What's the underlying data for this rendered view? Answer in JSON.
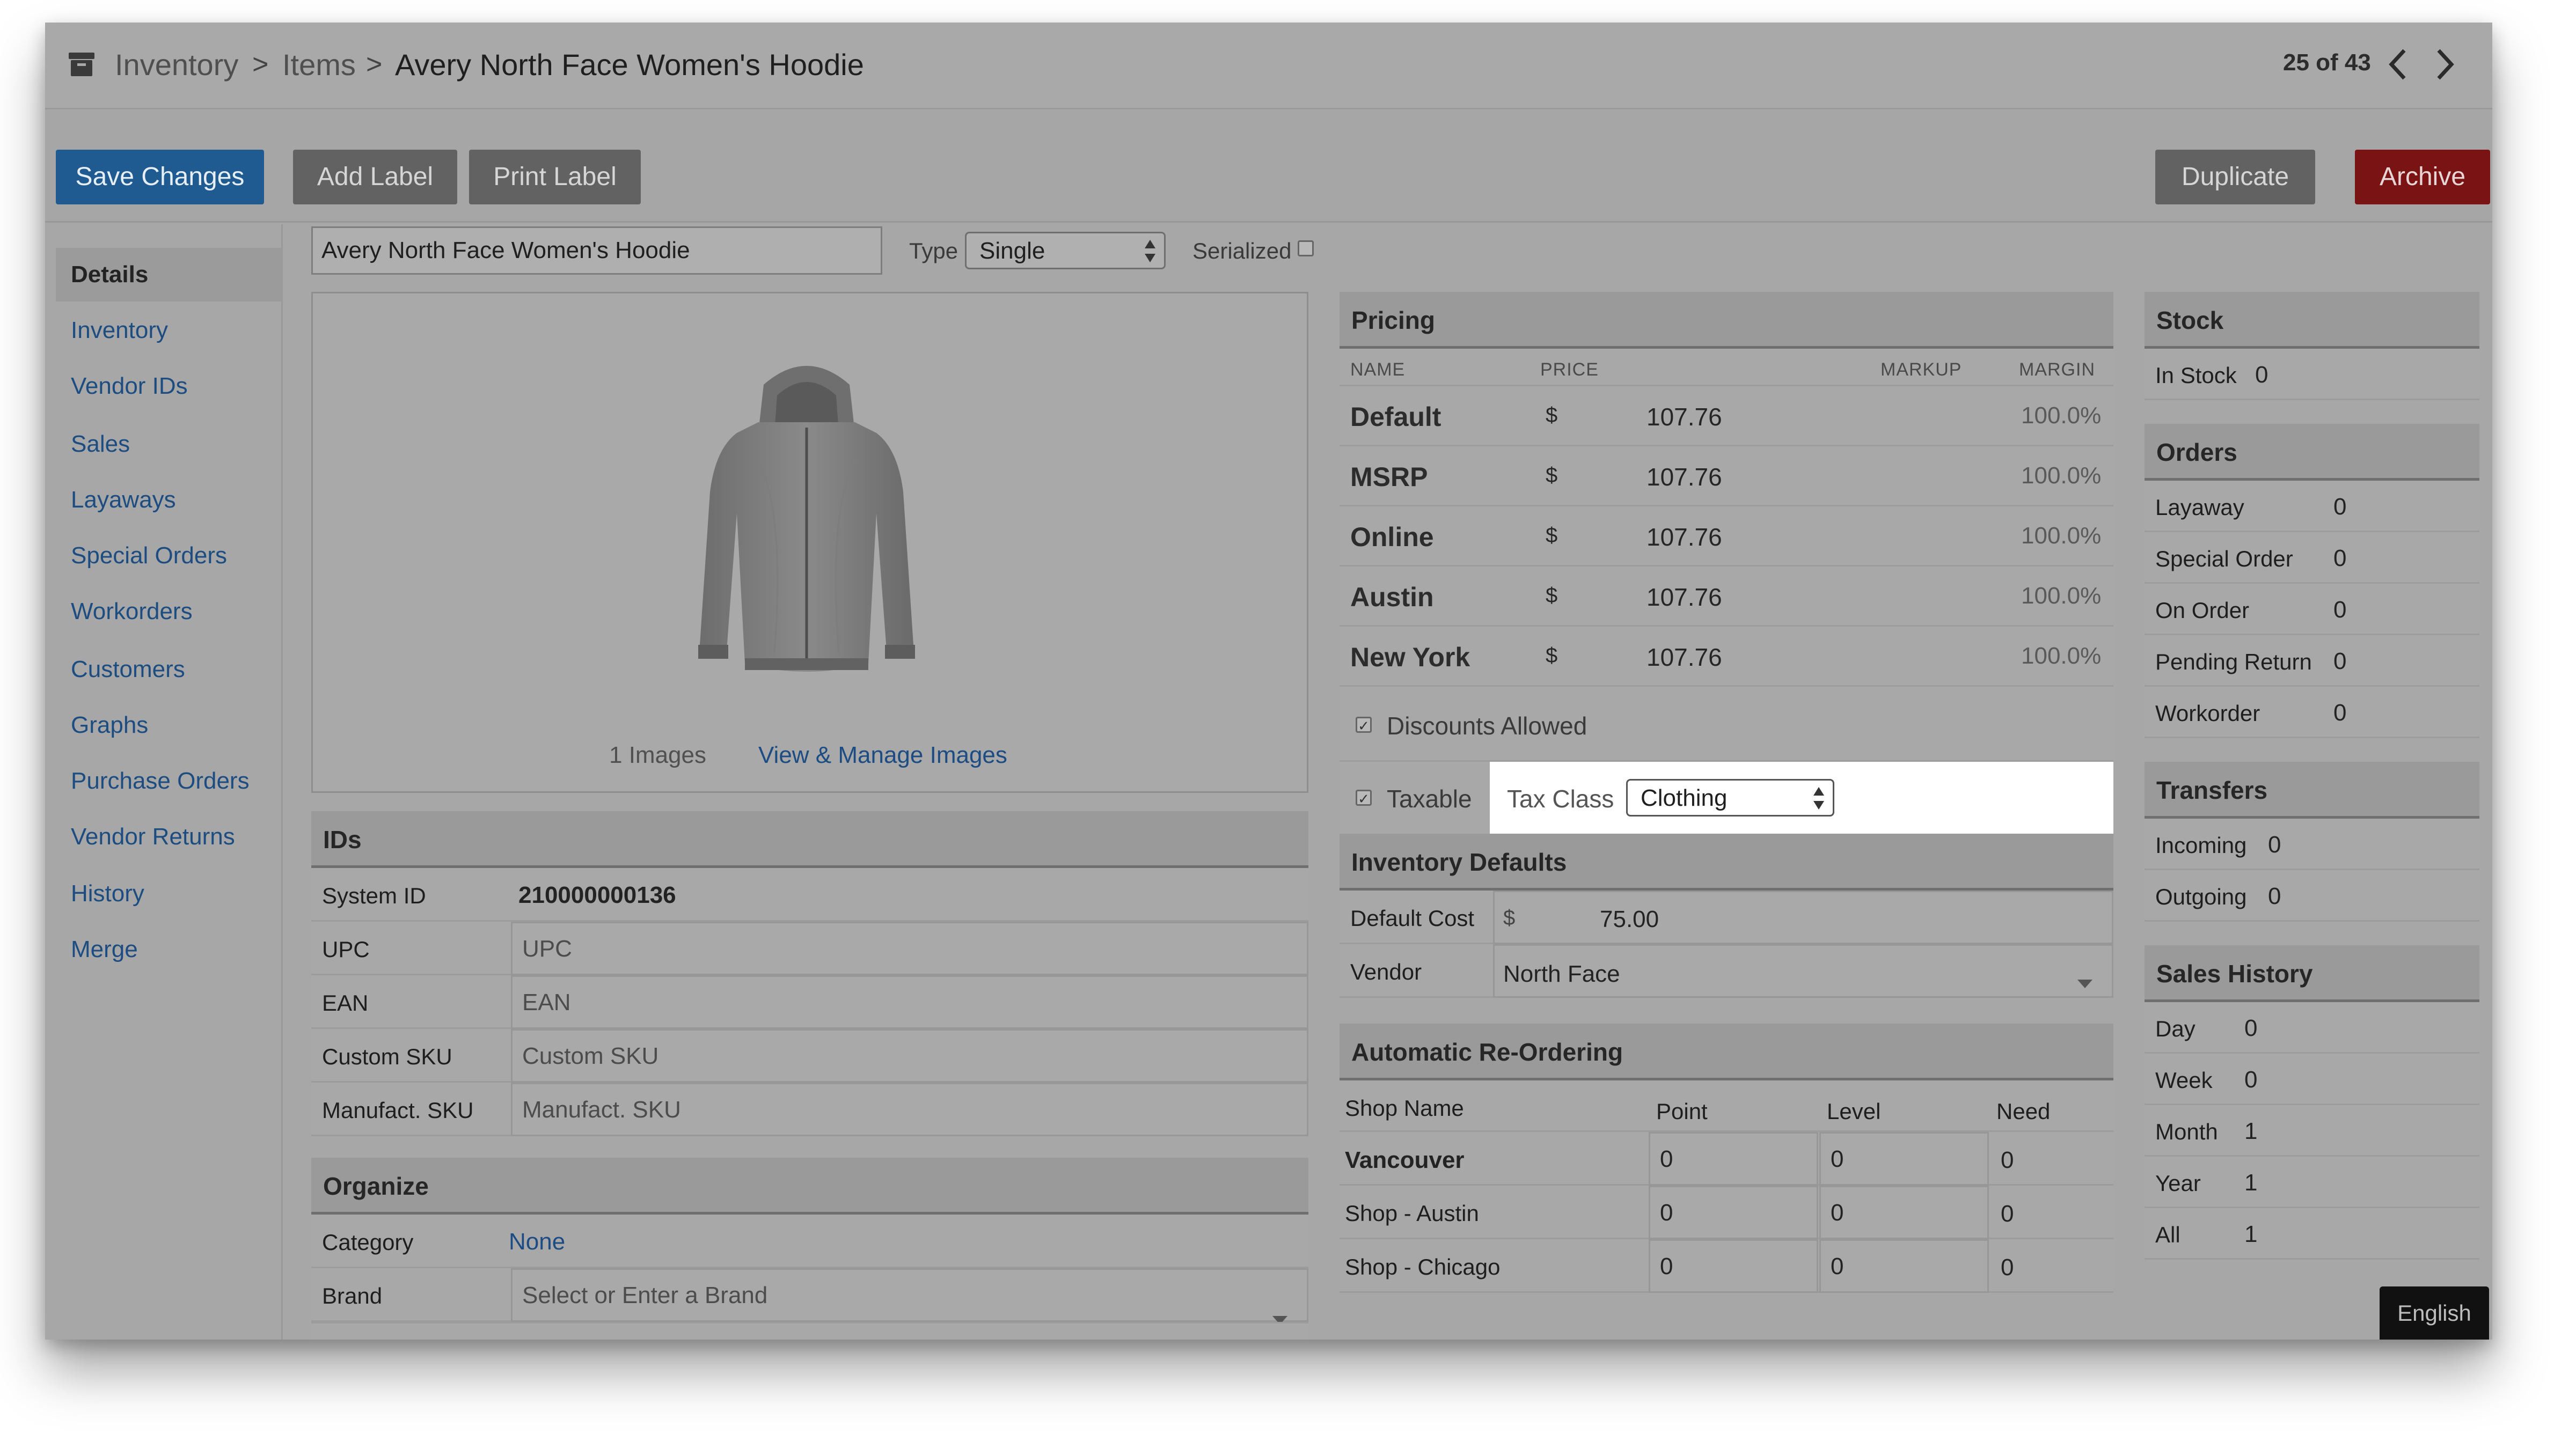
{
  "breadcrumb": {
    "items": [
      "Inventory",
      "Items",
      "Avery North Face Women's Hoodie"
    ],
    "separator": ">"
  },
  "pager": {
    "label": "25 of 43"
  },
  "toolbar": {
    "save": "Save Changes",
    "add_label": "Add Label",
    "print_label": "Print Label",
    "duplicate": "Duplicate",
    "archive": "Archive"
  },
  "sidebar": {
    "items": [
      "Details",
      "Inventory",
      "Vendor IDs",
      "Sales",
      "Layaways",
      "Special Orders",
      "Workorders",
      "Customers",
      "Graphs",
      "Purchase Orders",
      "Vendor Returns",
      "History",
      "Merge"
    ],
    "active": "Details"
  },
  "item": {
    "name": "Avery North Face Women's Hoodie",
    "type_label": "Type",
    "type_value": "Single",
    "serialized_label": "Serialized"
  },
  "images": {
    "count_text": "1 Images",
    "manage_link": "View & Manage Images"
  },
  "ids": {
    "title": "IDs",
    "system_id_label": "System ID",
    "system_id_value": "210000000136",
    "fields": [
      {
        "label": "UPC",
        "placeholder": "UPC"
      },
      {
        "label": "EAN",
        "placeholder": "EAN"
      },
      {
        "label": "Custom SKU",
        "placeholder": "Custom SKU"
      },
      {
        "label": "Manufact. SKU",
        "placeholder": "Manufact. SKU"
      }
    ]
  },
  "organize": {
    "title": "Organize",
    "category_label": "Category",
    "category_value": "None",
    "brand_label": "Brand",
    "brand_placeholder": "Select or Enter a Brand"
  },
  "pricing": {
    "title": "Pricing",
    "columns": {
      "name": "NAME",
      "price": "PRICE",
      "markup": "MARKUP",
      "margin": "MARGIN"
    },
    "currency": "$",
    "rows": [
      {
        "name": "Default",
        "price": "107.76",
        "margin": "100.0%"
      },
      {
        "name": "MSRP",
        "price": "107.76",
        "margin": "100.0%"
      },
      {
        "name": "Online",
        "price": "107.76",
        "margin": "100.0%"
      },
      {
        "name": "Austin",
        "price": "107.76",
        "margin": "100.0%"
      },
      {
        "name": "New York",
        "price": "107.76",
        "margin": "100.0%"
      }
    ],
    "discounts_label": "Discounts Allowed",
    "taxable_label": "Taxable",
    "tax_class_label": "Tax Class",
    "tax_class_value": "Clothing"
  },
  "inventory_defaults": {
    "title": "Inventory Defaults",
    "default_cost_label": "Default Cost",
    "currency": "$",
    "default_cost_value": "75.00",
    "vendor_label": "Vendor",
    "vendor_value": "North Face"
  },
  "reordering": {
    "title": "Automatic Re-Ordering",
    "columns": {
      "shop": "Shop Name",
      "point": "Point",
      "level": "Level",
      "need": "Need"
    },
    "rows": [
      {
        "shop": "Vancouver",
        "point": "0",
        "level": "0",
        "need": "0"
      },
      {
        "shop": "Shop - Austin",
        "point": "0",
        "level": "0",
        "need": "0"
      },
      {
        "shop": "Shop - Chicago",
        "point": "0",
        "level": "0",
        "need": "0"
      }
    ]
  },
  "stock": {
    "title": "Stock",
    "in_stock_label": "In Stock",
    "in_stock_value": "0"
  },
  "orders": {
    "title": "Orders",
    "rows": [
      {
        "label": "Layaway",
        "value": "0"
      },
      {
        "label": "Special Order",
        "value": "0"
      },
      {
        "label": "On Order",
        "value": "0"
      },
      {
        "label": "Pending Return",
        "value": "0"
      },
      {
        "label": "Workorder",
        "value": "0"
      }
    ]
  },
  "transfers": {
    "title": "Transfers",
    "rows": [
      {
        "label": "Incoming",
        "value": "0"
      },
      {
        "label": "Outgoing",
        "value": "0"
      }
    ]
  },
  "sales_history": {
    "title": "Sales History",
    "rows": [
      {
        "label": "Day",
        "value": "0"
      },
      {
        "label": "Week",
        "value": "0"
      },
      {
        "label": "Month",
        "value": "1"
      },
      {
        "label": "Year",
        "value": "1"
      },
      {
        "label": "All",
        "value": "1"
      }
    ]
  },
  "language": {
    "label": "English"
  },
  "colors": {
    "primary": "#1f5a91",
    "danger": "#7a1414",
    "link": "#1c4c82",
    "overlay": "#a7a7a7"
  }
}
